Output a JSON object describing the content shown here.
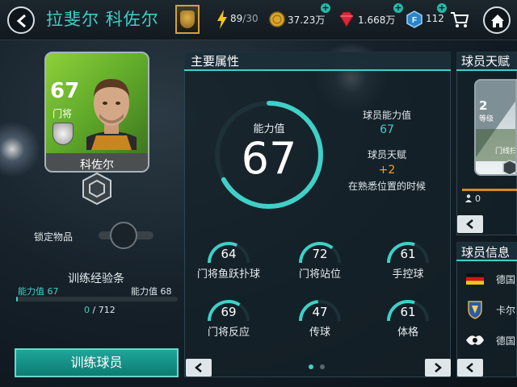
{
  "header": {
    "title": "拉斐尔 科佐尔",
    "stamina_current": "89",
    "stamina_max": "/30",
    "coins": "37.23万",
    "gems": "1.668万",
    "fifa_points": "112",
    "plus_symbol": "+"
  },
  "player_card": {
    "rating": "67",
    "position": "门将",
    "name": "科佐尔"
  },
  "lock": {
    "label": "锁定物品",
    "locked": false
  },
  "training": {
    "title": "训练经验条",
    "left_label": "能力值 67",
    "right_label": "能力值 68",
    "current": "0",
    "separator": " / ",
    "max": "712",
    "progress": 0.0,
    "button_label": "训练球员"
  },
  "main_attributes": {
    "title": "主要属性",
    "ring_label": "能力值",
    "ring_value": "67",
    "ring_fraction": 0.67,
    "player_rating_label": "球员能力值",
    "player_rating_value": "67",
    "talent_label": "球员天赋",
    "talent_value": "+2",
    "talent_desc": "在熟悉位置的时候",
    "stats": [
      {
        "label": "门将鱼跃扑球",
        "value": "64"
      },
      {
        "label": "门将站位",
        "value": "72"
      },
      {
        "label": "手控球",
        "value": "61"
      },
      {
        "label": "门将反应",
        "value": "69"
      },
      {
        "label": "传球",
        "value": "47"
      },
      {
        "label": "体格",
        "value": "61"
      }
    ],
    "page_index": 0,
    "page_count": 2
  },
  "talent_panel": {
    "title": "球员天赋",
    "level_number": "2",
    "level_label": "等级",
    "footer_text": "门线扫",
    "count": "0"
  },
  "info_panel": {
    "title": "球员信息",
    "rows": [
      {
        "text": "德国"
      },
      {
        "text": "卡尔"
      },
      {
        "text": "德国"
      }
    ]
  },
  "colors": {
    "accent": "#3fd0c8",
    "talent_orange": "#f0a030",
    "card_green": "#6fbb2e"
  }
}
